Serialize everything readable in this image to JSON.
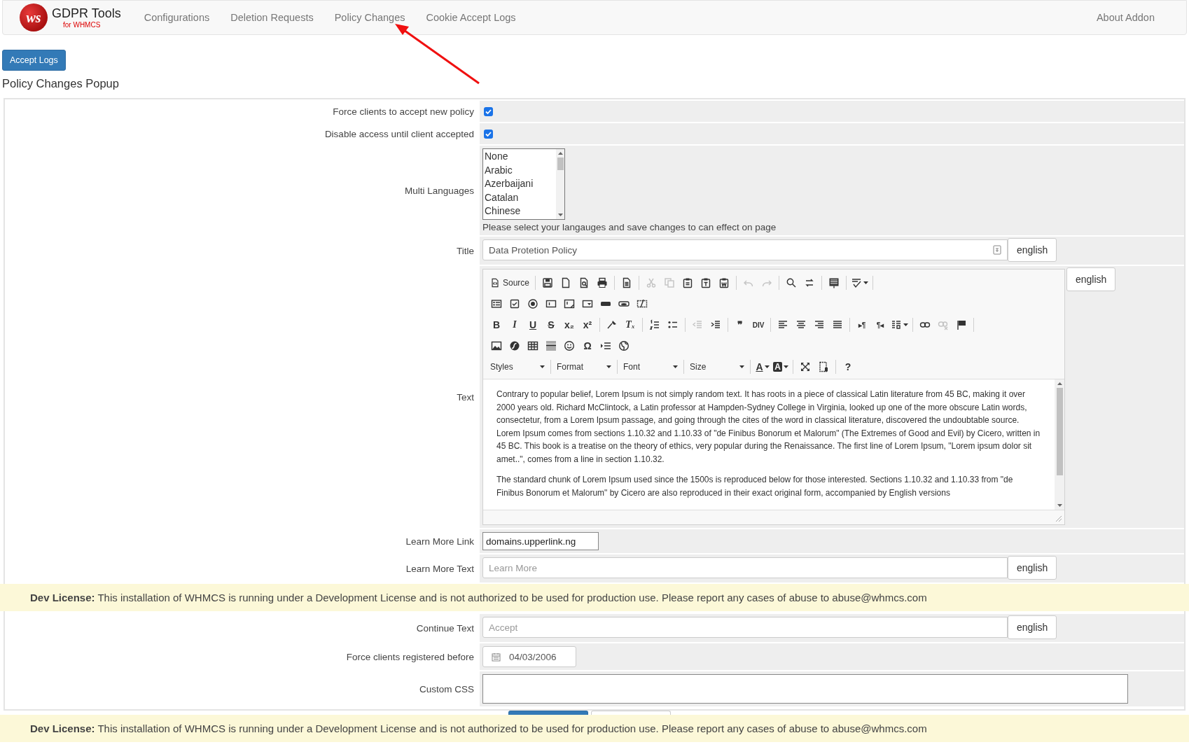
{
  "navbar": {
    "logo_mark": "ws",
    "brand": "GDPR Tools",
    "tagline": "for WHMCS",
    "items": [
      {
        "label": "Configurations",
        "selected": false
      },
      {
        "label": "Deletion Requests",
        "selected": false
      },
      {
        "label": "Policy Changes",
        "selected": false
      },
      {
        "label": "Cookie Accept Logs",
        "selected": false
      }
    ],
    "right_link": "About Addon"
  },
  "top_button": "Accept Logs",
  "heading": "Policy Changes Popup",
  "form": {
    "rows": [
      {
        "kind": "checkbox",
        "label": "Force clients to accept new policy",
        "checked": true
      },
      {
        "kind": "checkbox",
        "label": "Disable access until client accepted",
        "checked": true
      },
      {
        "kind": "listbox",
        "label": "Multi Languages",
        "options": [
          {
            "label": "None",
            "selected": false
          },
          {
            "label": "Arabic",
            "selected": false
          },
          {
            "label": "Azerbaijani",
            "selected": false
          },
          {
            "label": "Catalan",
            "selected": false
          },
          {
            "label": "Chinese",
            "selected": false
          }
        ],
        "help": "Please select your langauges and save changes to can effect on page"
      },
      {
        "kind": "text",
        "label": "Title",
        "value": "Data Protetion Policy",
        "language": "english"
      },
      {
        "kind": "editor",
        "label": "Text",
        "language": "english",
        "toolbar": [
          [
            {
              "kind": "source",
              "label": "Source"
            },
            {
              "kind": "separator"
            },
            {
              "kind": "save",
              "disabled": false
            },
            {
              "kind": "newpage",
              "disabled": false
            },
            {
              "kind": "preview",
              "disabled": false
            },
            {
              "kind": "print",
              "disabled": false
            },
            {
              "kind": "separator"
            },
            {
              "kind": "templates",
              "disabled": false
            },
            {
              "kind": "separator"
            },
            {
              "kind": "cut",
              "disabled": true
            },
            {
              "kind": "copy",
              "disabled": true
            },
            {
              "kind": "paste",
              "disabled": false
            },
            {
              "kind": "pastetext",
              "disabled": false
            },
            {
              "kind": "pasteword",
              "disabled": false
            },
            {
              "kind": "separator"
            },
            {
              "kind": "undo",
              "disabled": true
            },
            {
              "kind": "redo",
              "disabled": true
            },
            {
              "kind": "separator"
            },
            {
              "kind": "find",
              "disabled": false
            },
            {
              "kind": "replace",
              "disabled": false
            },
            {
              "kind": "separator"
            },
            {
              "kind": "selectall",
              "disabled": false
            },
            {
              "kind": "separator"
            },
            {
              "kind": "spellcheck",
              "disabled": false,
              "menu": true
            },
            {
              "kind": "separator"
            }
          ],
          [
            {
              "kind": "form",
              "disabled": false
            },
            {
              "kind": "checkbox",
              "disabled": false
            },
            {
              "kind": "radio",
              "disabled": false
            },
            {
              "kind": "textfield",
              "disabled": false
            },
            {
              "kind": "textarea",
              "disabled": false
            },
            {
              "kind": "select",
              "disabled": false
            },
            {
              "kind": "button",
              "disabled": false
            },
            {
              "kind": "imagebutton",
              "disabled": false
            },
            {
              "kind": "hiddenfield",
              "disabled": false
            }
          ],
          [
            {
              "kind": "bold",
              "label": "B",
              "disabled": false
            },
            {
              "kind": "italic",
              "label": "I",
              "disabled": false
            },
            {
              "kind": "underline",
              "label": "U",
              "disabled": false
            },
            {
              "kind": "strike",
              "label": "S",
              "disabled": false
            },
            {
              "kind": "subscript",
              "label": "x₂",
              "disabled": false
            },
            {
              "kind": "superscript",
              "label": "x²",
              "disabled": false
            },
            {
              "kind": "separator"
            },
            {
              "kind": "copyformat",
              "disabled": false
            },
            {
              "kind": "removeformat",
              "label": "Tₓ",
              "disabled": false
            },
            {
              "kind": "separator"
            },
            {
              "kind": "numlist",
              "disabled": false
            },
            {
              "kind": "bulletlist",
              "disabled": false
            },
            {
              "kind": "separator"
            },
            {
              "kind": "outdent",
              "disabled": true
            },
            {
              "kind": "indent",
              "disabled": false
            },
            {
              "kind": "separator"
            },
            {
              "kind": "blockquote",
              "label": "❞",
              "disabled": false
            },
            {
              "kind": "div",
              "label": "DIV",
              "disabled": false
            },
            {
              "kind": "separator"
            },
            {
              "kind": "alignleft",
              "disabled": false
            },
            {
              "kind": "aligncenter",
              "disabled": false
            },
            {
              "kind": "alignright",
              "disabled": false
            },
            {
              "kind": "justify",
              "disabled": false
            },
            {
              "kind": "separator"
            },
            {
              "kind": "ltr",
              "label": "▸¶",
              "disabled": false
            },
            {
              "kind": "rtl",
              "label": "¶◂",
              "disabled": false
            },
            {
              "kind": "language",
              "disabled": false,
              "menu": true
            },
            {
              "kind": "separator"
            },
            {
              "kind": "link",
              "disabled": false
            },
            {
              "kind": "unlink",
              "disabled": true
            },
            {
              "kind": "anchor",
              "disabled": false
            },
            {
              "kind": "separator"
            }
          ],
          [
            {
              "kind": "image",
              "disabled": false
            },
            {
              "kind": "flash",
              "disabled": false
            },
            {
              "kind": "table",
              "disabled": false
            },
            {
              "kind": "hr",
              "disabled": false
            },
            {
              "kind": "smiley",
              "disabled": false
            },
            {
              "kind": "specialchar",
              "label": "Ω",
              "disabled": false
            },
            {
              "kind": "pagebreak",
              "disabled": false
            },
            {
              "kind": "iframe",
              "disabled": false
            }
          ],
          [
            {
              "kind": "combo",
              "label": "Styles"
            },
            {
              "kind": "separator"
            },
            {
              "kind": "combo",
              "label": "Format"
            },
            {
              "kind": "separator"
            },
            {
              "kind": "combo",
              "label": "Font"
            },
            {
              "kind": "separator"
            },
            {
              "kind": "combo",
              "label": "Size"
            },
            {
              "kind": "separator"
            },
            {
              "kind": "textcolor",
              "label": "A",
              "disabled": false,
              "menu": true
            },
            {
              "kind": "bgcolor",
              "label": "A",
              "disabled": false,
              "menu": true
            },
            {
              "kind": "separator"
            },
            {
              "kind": "maximize",
              "disabled": false
            },
            {
              "kind": "showblocks",
              "disabled": false
            },
            {
              "kind": "separator"
            },
            {
              "kind": "about",
              "label": "?",
              "disabled": false
            }
          ]
        ],
        "paragraphs": [
          "Contrary to popular belief, Lorem Ipsum is not simply random text. It has roots in a piece of classical Latin literature from 45 BC, making it over 2000 years old. Richard McClintock, a Latin professor at Hampden-Sydney College in Virginia, looked up one of the more obscure Latin words, consectetur, from a Lorem Ipsum passage, and going through the cites of the word in classical literature, discovered the undoubtable source. Lorem Ipsum comes from sections 1.10.32 and 1.10.33 of \"de Finibus Bonorum et Malorum\" (The Extremes of Good and Evil) by Cicero, written in 45 BC. This book is a treatise on the theory of ethics, very popular during the Renaissance. The first line of Lorem Ipsum, \"Lorem ipsum dolor sit amet..\", comes from a line in section 1.10.32.",
          "The standard chunk of Lorem Ipsum used since the 1500s is reproduced below for those interested. Sections 1.10.32 and 1.10.33 from \"de Finibus Bonorum et Malorum\" by Cicero are also reproduced in their exact original form, accompanied by English versions"
        ]
      },
      {
        "kind": "input",
        "label": "Learn More Link",
        "value": "domains.upperlink.ng"
      },
      {
        "kind": "text",
        "label": "Learn More Text",
        "placeholder": "Learn More",
        "language": "english"
      },
      {
        "kind": "notice",
        "text": "**Dev License:** This installation of WHMCS is running under a Development License and is not authorized to be used for production use. Please report any cases of abuse to abuse@whmcs.com"
      },
      {
        "kind": "text",
        "label": "Continue Text",
        "placeholder": "Accept",
        "language": "english"
      },
      {
        "kind": "date",
        "label": "Force clients registered before",
        "value": "04/03/2006"
      },
      {
        "kind": "textarea",
        "label": "Custom CSS"
      }
    ]
  },
  "footer_notice": "**Dev License:** This installation of WHMCS is running under a Development License and is not authorized to be used for production use. Please report any cases of abuse to abuse@whmcs.com"
}
